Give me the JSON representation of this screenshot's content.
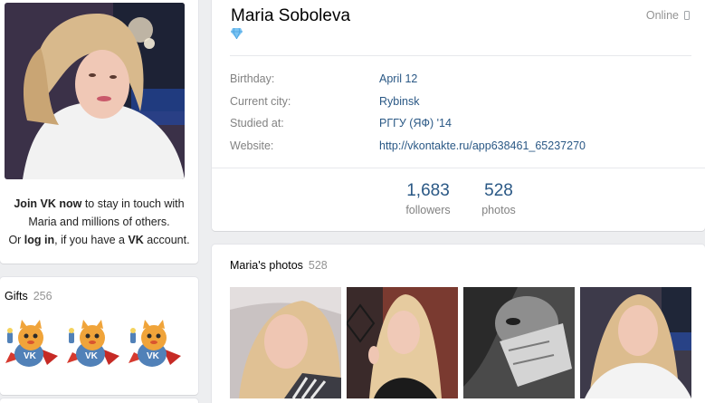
{
  "profile": {
    "name": "Maria Soboleva",
    "status": "Online",
    "join": {
      "strong1": "Join VK now",
      "text1": " to stay in touch with",
      "text2": "Maria and millions of others.",
      "text3": "Or ",
      "strong2": "log in",
      "text4": ", if you have a ",
      "strong3": "VK",
      "text5": " account."
    }
  },
  "info": [
    {
      "label": "Birthday:",
      "value": "April 12"
    },
    {
      "label": "Current city:",
      "value": "Rybinsk"
    },
    {
      "label": "Studied at:",
      "value": "РГГУ (ЯФ) '14"
    },
    {
      "label": "Website:",
      "value": "http://vkontakte.ru/app638461_65237270"
    }
  ],
  "counters": [
    {
      "num": "1,683",
      "label": "followers"
    },
    {
      "num": "528",
      "label": "photos"
    }
  ],
  "gifts": {
    "title": "Gifts",
    "count": "256"
  },
  "photos": {
    "title": "Maria's photos",
    "count": "528"
  },
  "colors": {
    "link": "#2a5885",
    "muted": "#828282",
    "background": "#edeef0"
  },
  "icons": [
    "diamond-icon",
    "phone-icon",
    "cat-gift-icon"
  ]
}
